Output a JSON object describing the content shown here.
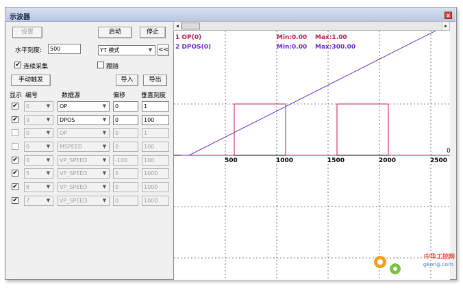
{
  "window": {
    "title": "示波器",
    "close_glyph": "x"
  },
  "toolbar": {
    "settings_label": "设置",
    "start_label": "启动",
    "stop_label": "停止",
    "hscale_label": "水平刻度:",
    "hscale_value": "500",
    "mode_value": "YT 模式",
    "collapse_label": "<<",
    "continuous_label": "连续采集",
    "continuous_checked": "✔",
    "follow_label": "跟随",
    "manual_trigger_label": "手动触发",
    "import_label": "导入",
    "export_label": "导出"
  },
  "table": {
    "headers": [
      "显示",
      "编号",
      "数据源",
      "偏移",
      "垂直刻度"
    ],
    "rows": [
      {
        "show": "✔",
        "num": "0",
        "source": "OP",
        "offset": "0",
        "scale": "1",
        "enabled": true
      },
      {
        "show": "✔",
        "num": "0",
        "source": "DPOS",
        "offset": "0",
        "scale": "100",
        "enabled": true
      },
      {
        "show": "",
        "num": "0",
        "source": "OP",
        "offset": "0",
        "scale": "1",
        "enabled": false
      },
      {
        "show": "",
        "num": "0",
        "source": "MSPEED",
        "offset": "0",
        "scale": "100",
        "enabled": false
      },
      {
        "show": "✔",
        "num": "0",
        "source": "VP_SPEED",
        "offset": "-100",
        "scale": "100",
        "enabled": false
      },
      {
        "show": "✔",
        "num": "5",
        "source": "VP_SPEED",
        "offset": "0",
        "scale": "1000",
        "enabled": false
      },
      {
        "show": "✔",
        "num": "6",
        "source": "VP_SPEED",
        "offset": "0",
        "scale": "1000",
        "enabled": false
      },
      {
        "show": "✔",
        "num": "7",
        "source": "VP_SPEED",
        "offset": "0",
        "scale": "1000",
        "enabled": false
      }
    ]
  },
  "plot": {
    "legend": [
      {
        "name": "1 OP(0)",
        "min": "Min:0.00",
        "max": "Max:1.00",
        "color": "#c0194a"
      },
      {
        "name": "2 DPOS(0)",
        "min": "Min:0.00",
        "max": "Max:300.00",
        "color": "#6a2ad0"
      }
    ],
    "x_ticks": [
      "500",
      "1000",
      "1500",
      "2000",
      "2500"
    ],
    "zero_label": "0"
  },
  "scrollbar": {
    "left_arrow": "◂",
    "right_arrow": "▸"
  },
  "watermark": {
    "line1": "中华工控网",
    "line2": "gkong.com"
  },
  "chart_data": {
    "type": "line",
    "x_ticks": [
      500,
      1000,
      1500,
      2000,
      2500
    ],
    "series": [
      {
        "name": "1 OP(0)",
        "x": [
          0,
          520,
          520,
          1020,
          1020,
          1520,
          1520,
          2020,
          2020,
          2700
        ],
        "y": [
          0,
          0,
          1,
          1,
          0,
          0,
          1,
          1,
          0,
          0
        ],
        "color": "#c0194a"
      },
      {
        "name": "2 DPOS(0)",
        "x": [
          0,
          80,
          2480
        ],
        "y": [
          0,
          0,
          300
        ],
        "color": "#6a2ad0"
      }
    ]
  }
}
